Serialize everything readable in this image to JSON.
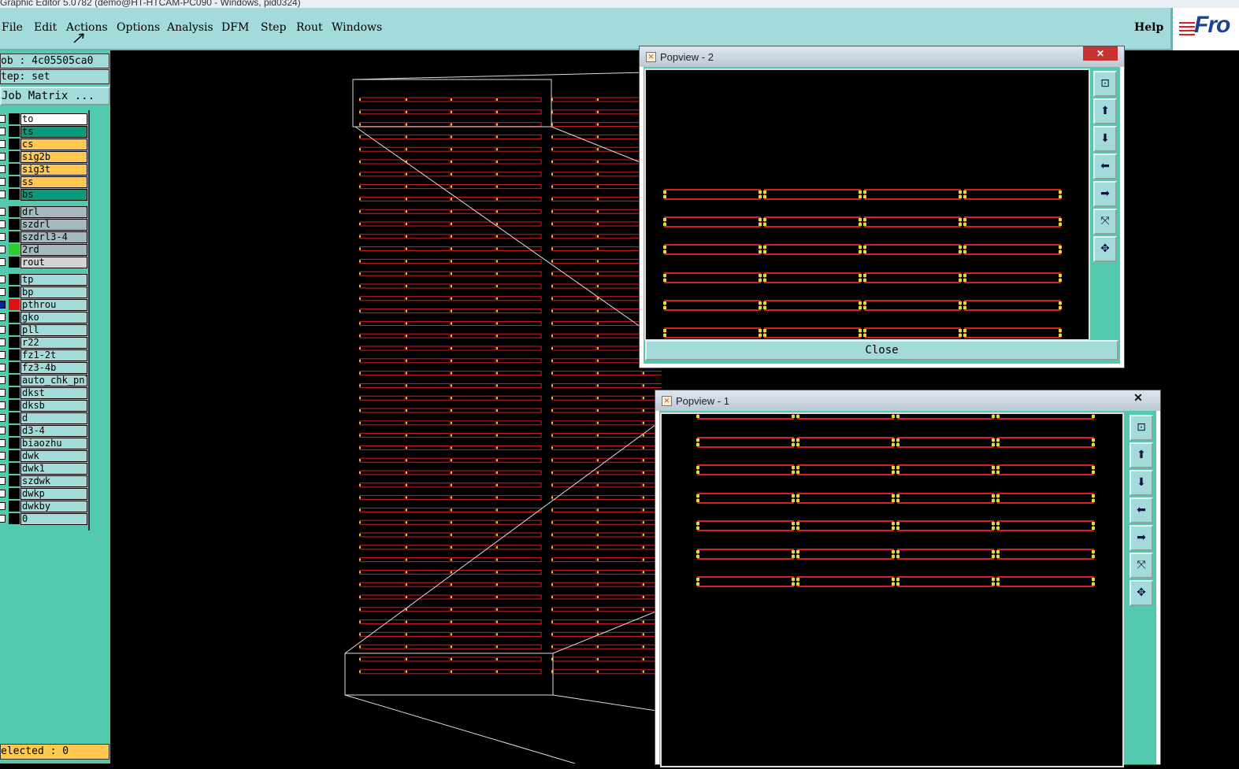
{
  "window_title": "Graphic Editor 5.0782 (demo@HT-HTCAM-PC090 - Windows, pid0324)",
  "menu": [
    "File",
    "Edit",
    "Actions",
    "Options",
    "Analysis",
    "DFM",
    "Step",
    "Rout",
    "Windows"
  ],
  "help_label": "Help",
  "logo_text": "Fro",
  "job_label": "ob : 4c05505ca0",
  "step_label": "tep: set",
  "job_matrix_label": "Job Matrix ...",
  "layers": [
    {
      "name": "to",
      "bg": "#ffffff",
      "color": "#000000"
    },
    {
      "name": "ts",
      "bg": "#0a9a7a",
      "color": "#000000"
    },
    {
      "name": "cs",
      "bg": "#ffc850",
      "color": "#000000"
    },
    {
      "name": "sig2b",
      "bg": "#ffc850",
      "color": "#000000"
    },
    {
      "name": "sig3t",
      "bg": "#ffc850",
      "color": "#000000"
    },
    {
      "name": "ss",
      "bg": "#ffc850",
      "color": "#000000"
    },
    {
      "name": "bs",
      "bg": "#0a9a7a",
      "color": "#000000"
    },
    {
      "name": "drl",
      "bg": "#a3b8bf",
      "color": "#000000"
    },
    {
      "name": "szdrl",
      "bg": "#a3b8bf",
      "color": "#000000"
    },
    {
      "name": "szdrl3-4",
      "bg": "#a3b8bf",
      "color": "#000000"
    },
    {
      "name": "2rd",
      "bg": "#a3b8bf",
      "color": "#2ecc2e"
    },
    {
      "name": "rout",
      "bg": "#d3d3d3",
      "color": "#000000"
    },
    {
      "name": "tp",
      "bg": "#a3dada",
      "color": "#000000"
    },
    {
      "name": "bp",
      "bg": "#a3dada",
      "color": "#000000"
    },
    {
      "name": "pthrou",
      "bg": "#a3dada",
      "color": "#e01010",
      "active": true
    },
    {
      "name": "gko",
      "bg": "#a3dada",
      "color": "#000000"
    },
    {
      "name": "pll",
      "bg": "#a3dada",
      "color": "#000000"
    },
    {
      "name": "r22",
      "bg": "#a3dada",
      "color": "#000000"
    },
    {
      "name": "fz1-2t",
      "bg": "#a3dada",
      "color": "#000000"
    },
    {
      "name": "fz3-4b",
      "bg": "#a3dada",
      "color": "#000000"
    },
    {
      "name": "auto_chk_pnl",
      "bg": "#a3dada",
      "color": "#000000"
    },
    {
      "name": "dkst",
      "bg": "#a3dada",
      "color": "#000000"
    },
    {
      "name": "dksb",
      "bg": "#a3dada",
      "color": "#000000"
    },
    {
      "name": "d",
      "bg": "#a3dada",
      "color": "#000000"
    },
    {
      "name": "d3-4",
      "bg": "#a3dada",
      "color": "#000000"
    },
    {
      "name": "biaozhu",
      "bg": "#a3dada",
      "color": "#000000"
    },
    {
      "name": "dwk",
      "bg": "#a3dada",
      "color": "#000000"
    },
    {
      "name": "dwk1",
      "bg": "#a3dada",
      "color": "#000000"
    },
    {
      "name": "szdwk",
      "bg": "#a3dada",
      "color": "#000000"
    },
    {
      "name": "dwkp",
      "bg": "#a3dada",
      "color": "#000000"
    },
    {
      "name": "dwkby",
      "bg": "#a3dada",
      "color": "#000000"
    },
    {
      "name": "0",
      "bg": "#a3dada",
      "color": "#000000"
    }
  ],
  "selected_label": "elected : 0",
  "popview2": {
    "title": "Popview - 2",
    "close_label": "Close",
    "close_x": "✕"
  },
  "popview1": {
    "title": "Popview - 1",
    "close_x": "✕"
  },
  "tools": [
    "zoom-window-icon",
    "pan-up-icon",
    "pan-down-icon",
    "pan-left-icon",
    "pan-right-icon",
    "zoom-fit-icon",
    "zoom-center-icon"
  ],
  "colors": {
    "accent": "#a3dada",
    "panel": "#53c9b0",
    "trace": "#d42020",
    "pad": "#e8c030"
  }
}
